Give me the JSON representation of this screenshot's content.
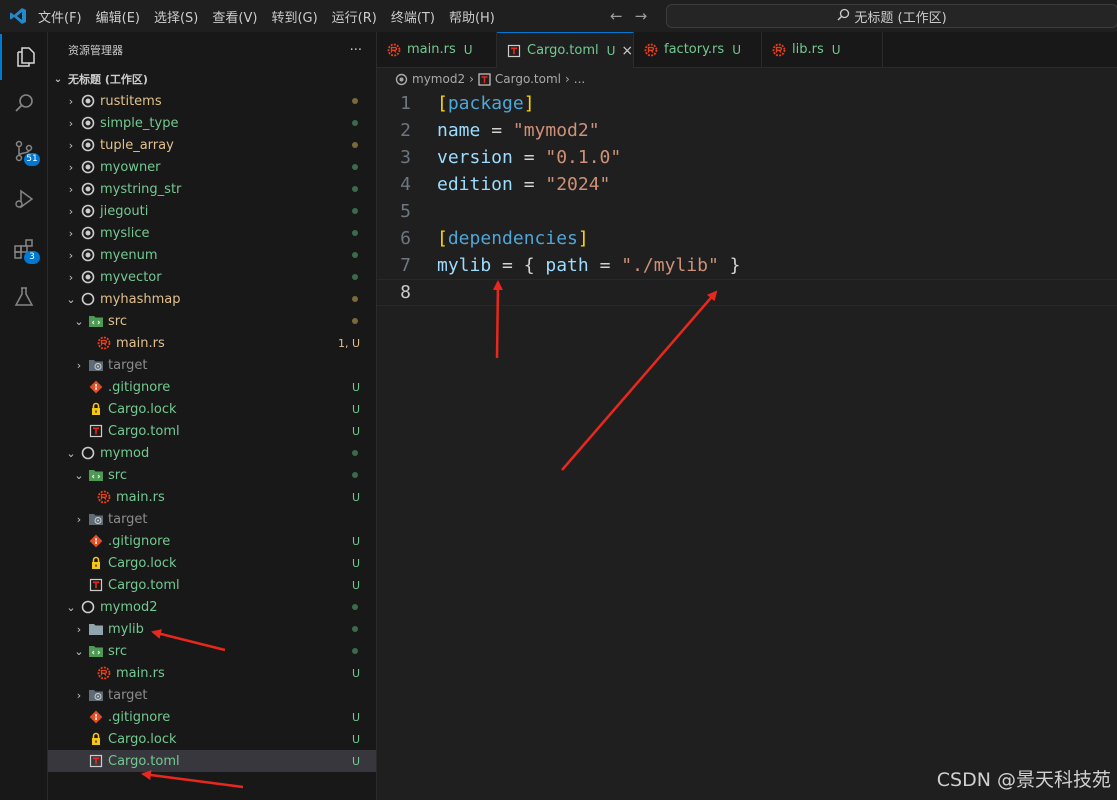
{
  "menu": [
    "文件(F)",
    "编辑(E)",
    "选择(S)",
    "查看(V)",
    "转到(G)",
    "运行(R)",
    "终端(T)",
    "帮助(H)"
  ],
  "command_center": "无标题 (工作区)",
  "activity": {
    "scm_badge": "51",
    "extensions_badge": "3"
  },
  "sidebar": {
    "header": "资源管理器",
    "more": "···",
    "workspace": "无标题 (工作区)",
    "rows": [
      {
        "depth": 0,
        "chev": "›",
        "icon": "circle-dot",
        "name": "rustitems",
        "color": "#e2c08d",
        "dot": "#7a6a3a"
      },
      {
        "depth": 0,
        "chev": "›",
        "icon": "circle-dot",
        "name": "simple_type",
        "color": "#73c991",
        "dot": "#3b6b4b"
      },
      {
        "depth": 0,
        "chev": "›",
        "icon": "circle-dot",
        "name": "tuple_array",
        "color": "#e2c08d",
        "dot": "#7a6a3a"
      },
      {
        "depth": 0,
        "chev": "›",
        "icon": "circle-dot",
        "name": "myowner",
        "color": "#73c991",
        "dot": "#3b6b4b"
      },
      {
        "depth": 0,
        "chev": "›",
        "icon": "circle-dot",
        "name": "mystring_str",
        "color": "#73c991",
        "dot": "#3b6b4b"
      },
      {
        "depth": 0,
        "chev": "›",
        "icon": "circle-dot",
        "name": "jiegouti",
        "color": "#73c991",
        "dot": "#3b6b4b"
      },
      {
        "depth": 0,
        "chev": "›",
        "icon": "circle-dot",
        "name": "myslice",
        "color": "#73c991",
        "dot": "#3b6b4b"
      },
      {
        "depth": 0,
        "chev": "›",
        "icon": "circle-dot",
        "name": "myenum",
        "color": "#73c991",
        "dot": "#3b6b4b"
      },
      {
        "depth": 0,
        "chev": "›",
        "icon": "circle-dot",
        "name": "myvector",
        "color": "#73c991",
        "dot": "#3b6b4b"
      },
      {
        "depth": 0,
        "chev": "⌄",
        "icon": "circle",
        "name": "myhashmap",
        "color": "#e2c08d",
        "dot": "#7a6a3a"
      },
      {
        "depth": 1,
        "chev": "⌄",
        "icon": "src-folder",
        "name": "src",
        "color": "#e2c08d",
        "dot": "#7a6a3a"
      },
      {
        "depth": 2,
        "chev": "",
        "icon": "rust",
        "name": "main.rs",
        "color": "#e2c08d",
        "status": "1, U",
        "statcolor": "#e2c08d"
      },
      {
        "depth": 1,
        "chev": "›",
        "icon": "target-folder",
        "name": "target",
        "color": "#8c8c8c"
      },
      {
        "depth": 1,
        "chev": "",
        "icon": "git",
        "name": ".gitignore",
        "color": "#73c991",
        "status": "U",
        "statcolor": "#73c991"
      },
      {
        "depth": 1,
        "chev": "",
        "icon": "lock",
        "name": "Cargo.lock",
        "color": "#73c991",
        "status": "U",
        "statcolor": "#73c991"
      },
      {
        "depth": 1,
        "chev": "",
        "icon": "toml",
        "name": "Cargo.toml",
        "color": "#73c991",
        "status": "U",
        "statcolor": "#73c991"
      },
      {
        "depth": 0,
        "chev": "⌄",
        "icon": "circle",
        "name": "mymod",
        "color": "#73c991",
        "dot": "#3b6b4b"
      },
      {
        "depth": 1,
        "chev": "⌄",
        "icon": "src-folder",
        "name": "src",
        "color": "#73c991",
        "dot": "#3b6b4b"
      },
      {
        "depth": 2,
        "chev": "",
        "icon": "rust",
        "name": "main.rs",
        "color": "#73c991",
        "status": "U",
        "statcolor": "#73c991"
      },
      {
        "depth": 1,
        "chev": "›",
        "icon": "target-folder",
        "name": "target",
        "color": "#8c8c8c"
      },
      {
        "depth": 1,
        "chev": "",
        "icon": "git",
        "name": ".gitignore",
        "color": "#73c991",
        "status": "U",
        "statcolor": "#73c991"
      },
      {
        "depth": 1,
        "chev": "",
        "icon": "lock",
        "name": "Cargo.lock",
        "color": "#73c991",
        "status": "U",
        "statcolor": "#73c991"
      },
      {
        "depth": 1,
        "chev": "",
        "icon": "toml",
        "name": "Cargo.toml",
        "color": "#73c991",
        "status": "U",
        "statcolor": "#73c991"
      },
      {
        "depth": 0,
        "chev": "⌄",
        "icon": "circle",
        "name": "mymod2",
        "color": "#73c991",
        "dot": "#3b6b4b"
      },
      {
        "depth": 1,
        "chev": "›",
        "icon": "folder",
        "name": "mylib",
        "color": "#73c991",
        "dot": "#3b6b4b"
      },
      {
        "depth": 1,
        "chev": "⌄",
        "icon": "src-folder",
        "name": "src",
        "color": "#73c991",
        "dot": "#3b6b4b"
      },
      {
        "depth": 2,
        "chev": "",
        "icon": "rust",
        "name": "main.rs",
        "color": "#73c991",
        "status": "U",
        "statcolor": "#73c991"
      },
      {
        "depth": 1,
        "chev": "›",
        "icon": "target-folder",
        "name": "target",
        "color": "#8c8c8c"
      },
      {
        "depth": 1,
        "chev": "",
        "icon": "git",
        "name": ".gitignore",
        "color": "#73c991",
        "status": "U",
        "statcolor": "#73c991"
      },
      {
        "depth": 1,
        "chev": "",
        "icon": "lock",
        "name": "Cargo.lock",
        "color": "#73c991",
        "status": "U",
        "statcolor": "#73c991"
      },
      {
        "depth": 1,
        "chev": "",
        "icon": "toml",
        "name": "Cargo.toml",
        "color": "#73c991",
        "status": "U",
        "statcolor": "#73c991",
        "selected": true
      }
    ]
  },
  "tabs": [
    {
      "name": "main.rs",
      "icon": "rust",
      "flag": "U",
      "active": false
    },
    {
      "name": "Cargo.toml",
      "icon": "toml",
      "flag": "U",
      "active": true,
      "close": "×"
    },
    {
      "name": "factory.rs",
      "icon": "rust",
      "flag": "U",
      "active": false
    },
    {
      "name": "lib.rs",
      "icon": "rust",
      "flag": "U",
      "active": false
    }
  ],
  "breadcrumb": {
    "folder": "mymod2",
    "sep": "›",
    "file": "Cargo.toml",
    "more": "..."
  },
  "editor": {
    "lines": [
      {
        "n": "1",
        "tokens": [
          [
            "br",
            "["
          ],
          [
            "sec",
            "package"
          ],
          [
            "br",
            "]"
          ]
        ]
      },
      {
        "n": "2",
        "tokens": [
          [
            "key",
            "name"
          ],
          [
            "op",
            " = "
          ],
          [
            "str",
            "\"mymod2\""
          ]
        ]
      },
      {
        "n": "3",
        "tokens": [
          [
            "key",
            "version"
          ],
          [
            "op",
            " = "
          ],
          [
            "str",
            "\"0.1.0\""
          ]
        ]
      },
      {
        "n": "4",
        "tokens": [
          [
            "key",
            "edition"
          ],
          [
            "op",
            " = "
          ],
          [
            "str",
            "\"2024\""
          ]
        ]
      },
      {
        "n": "5",
        "tokens": []
      },
      {
        "n": "6",
        "tokens": [
          [
            "br",
            "["
          ],
          [
            "sec",
            "dependencies"
          ],
          [
            "br",
            "]"
          ]
        ]
      },
      {
        "n": "7",
        "tokens": [
          [
            "key",
            "mylib"
          ],
          [
            "op",
            " = { "
          ],
          [
            "key",
            "path"
          ],
          [
            "op",
            " = "
          ],
          [
            "str",
            "\"./mylib\""
          ],
          [
            "op",
            " }"
          ]
        ]
      },
      {
        "n": "8",
        "tokens": [],
        "current": true
      }
    ]
  },
  "watermark": "CSDN @景天科技苑",
  "colors": {
    "accent": "#0078d4",
    "untracked": "#73c991",
    "modified": "#e2c08d",
    "annotation": "#e8281c"
  }
}
